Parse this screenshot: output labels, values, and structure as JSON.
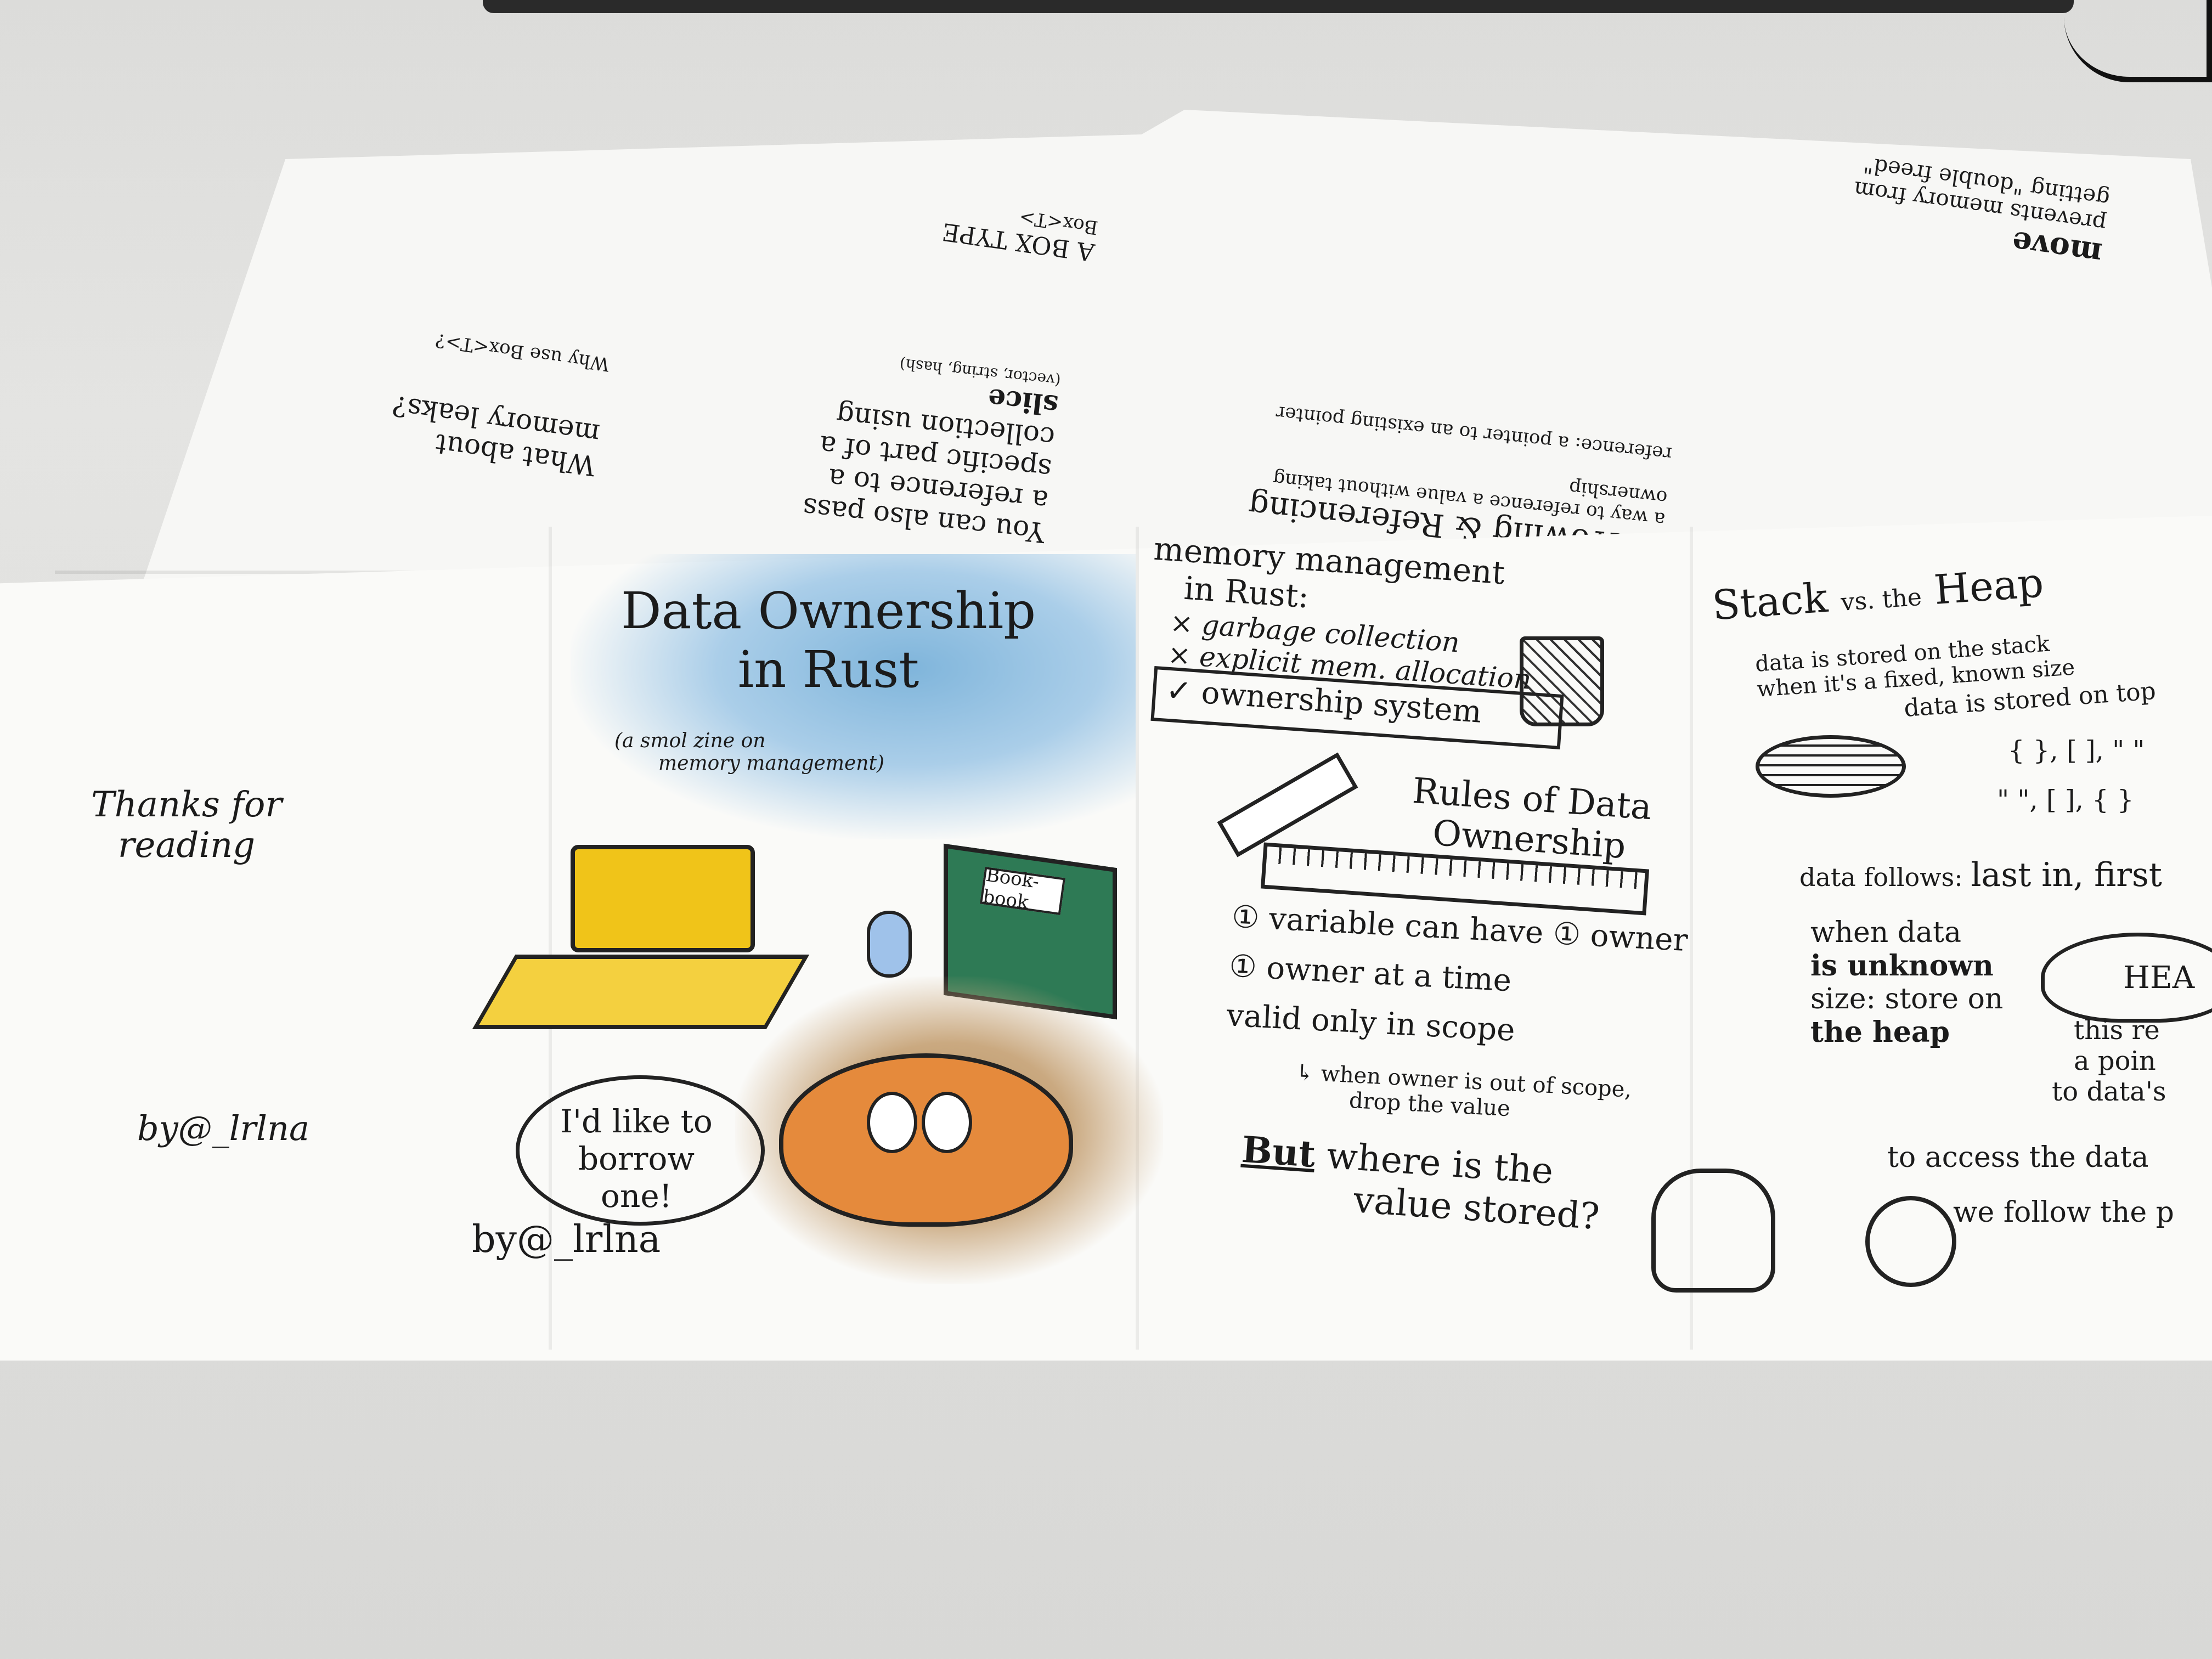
{
  "cover": {
    "title_line1": "Data Ownership",
    "title_line2": "in Rust",
    "subtitle_line1": "(a smol zine on",
    "subtitle_line2": "memory management)",
    "speech": "I'd like to borrow one!",
    "author": "by@_lrlna",
    "book_label": "Book-book"
  },
  "back_cover": {
    "thanks_line1": "Thanks for",
    "thanks_line2": "reading",
    "author": "by@_lrlna"
  },
  "memory_panel": {
    "heading_line1": "memory management",
    "heading_line2": "in Rust:",
    "items": [
      "× garbage collection",
      "× explicit mem. allocation"
    ],
    "checked": "✓ ownership system",
    "rules_line1": "Rules of Data",
    "rules_line2": "Ownership",
    "rules": [
      "① variable can have ① owner",
      "① owner at a time",
      "valid only in scope"
    ],
    "scope_note_line1": "↳ when owner is out of scope,",
    "scope_note_line2": "drop the value",
    "question_lead": "But",
    "question_line1": "where is the",
    "question_line2": "value stored?"
  },
  "stack_heap_panel": {
    "title_left": "Stack",
    "title_mid": "vs. the",
    "title_right": "Heap",
    "note1_line1": "data is stored on the stack",
    "note1_line2": "when it's a fixed, known size",
    "note2": "data is stored on top",
    "symbols1": "{ }, [ ], \" \"",
    "symbols2": "\" \", [ ], { }",
    "follows_lead": "data follows:",
    "follows_value": "last in, first",
    "unknown_line1": "when data",
    "unknown_line2": "is unknown",
    "unknown_line3": "size: store on",
    "unknown_line4": "the heap",
    "heap_label": "HEA",
    "pointer_line1": "this re",
    "pointer_line2": "a poin",
    "pointer_line3": "to data's",
    "access": "to access the data",
    "follow": "we follow the p"
  },
  "top_row": {
    "borrowing_title": "Borrowing & Referencing",
    "borrowing_sub": "a way to reference a value without taking ownership",
    "reference_note": "reference: a pointer to an existing pointer",
    "slice_line1": "You can also pass",
    "slice_line2": "a reference to a",
    "slice_line3": "specific part of a",
    "slice_line4": "collection using",
    "slice_word": "slice",
    "slice_note": "(vector, string, hash)",
    "box_title": "A BOX TYPE",
    "box_sub": "Box<T>",
    "what_about": "What about",
    "memory_leaks": "memory leaks?",
    "why_box": "Why use Box<T>?",
    "move_word": "move",
    "prevents": "prevents memory from getting \"double freed\""
  },
  "icons": {
    "trash": "trash-can-icon",
    "pencil": "pencil-icon",
    "ruler": "ruler-icon",
    "backpack": "backpack-icon",
    "crab": "ferris-crab-icon",
    "computer": "computer-icon",
    "mouse": "mouse-icon",
    "book": "book-icon",
    "key": "key-icon",
    "plates": "stack-plates-icon",
    "cloud": "heap-cloud-icon"
  },
  "colors": {
    "ink": "#1b1b1b",
    "sky_blue": "#6aa9d6",
    "crab_orange": "#e58a3c",
    "computer_yellow": "#f0c419",
    "book_green": "#2e7a55",
    "paper": "#fafaf8"
  }
}
